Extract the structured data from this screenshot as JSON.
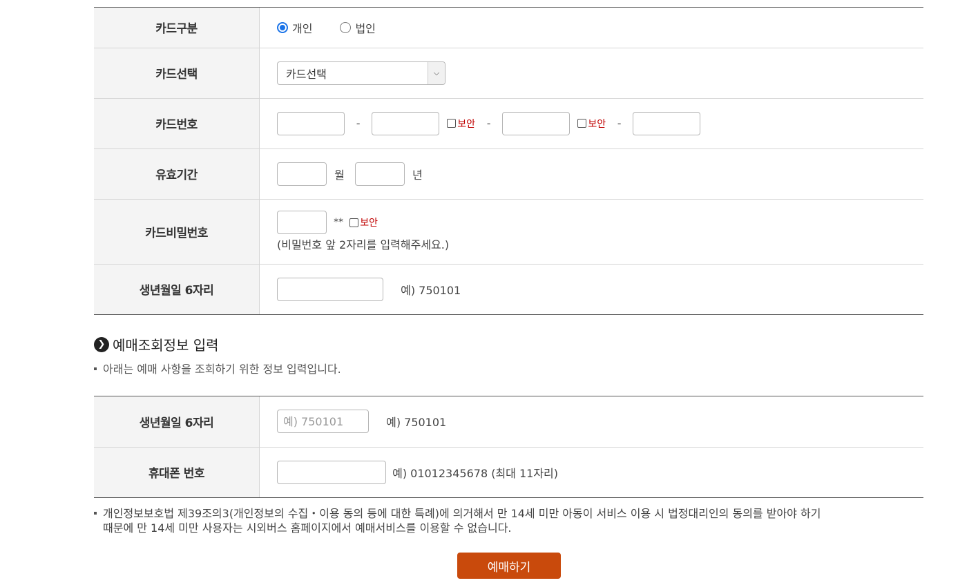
{
  "payment": {
    "card_type": {
      "label": "카드구분",
      "options": [
        {
          "label": "개인",
          "selected": true
        },
        {
          "label": "법인",
          "selected": false
        }
      ]
    },
    "card_select": {
      "label": "카드선택",
      "value": "카드선택"
    },
    "card_number": {
      "label": "카드번호",
      "dash": "-",
      "secure_label": "보안"
    },
    "expiry": {
      "label": "유효기간",
      "month_unit": "월",
      "year_unit": "년"
    },
    "card_password": {
      "label": "카드비밀번호",
      "mask": "**",
      "secure_label": "보안",
      "note": "(비밀번호 앞 2자리를 입력해주세요.)"
    },
    "birth": {
      "label": "생년월일 6자리",
      "hint": "예) 750101"
    }
  },
  "inquiry": {
    "title": "예매조회정보 입력",
    "description": "아래는 예매 사항을 조회하기 위한 정보 입력입니다.",
    "birth": {
      "label": "생년월일 6자리",
      "placeholder": "예) 750101",
      "hint": "예) 750101"
    },
    "phone": {
      "label": "휴대폰 번호",
      "hint": "예) 01012345678 (최대 11자리)"
    }
  },
  "notice": {
    "line1": "개인정보보호법 제39조의3(개인정보의 수집・이용 동의 등에 대한 특례)에 의거해서 만 14세 미만 아동이 서비스 이용 시 법정대리인의 동의를 받아야 하기",
    "line2": "때문에 만 14세 미만 사용자는 시외버스 홈페이지에서 예매서비스를 이용할 수 없습니다."
  },
  "submit_label": "예매하기",
  "colors": {
    "accent": "#c94a0c",
    "secure": "#c00000",
    "radio": "#1a73e8"
  }
}
